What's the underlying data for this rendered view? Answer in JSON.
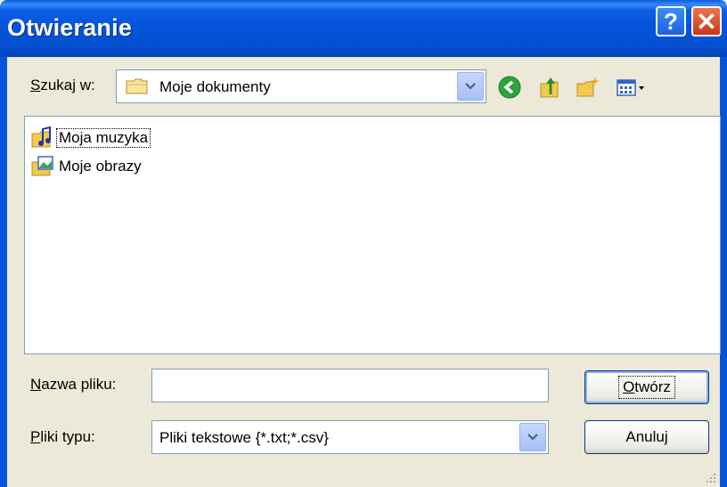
{
  "window": {
    "title": "Otwieranie",
    "help_label": "?",
    "close_label": "✕"
  },
  "lookin": {
    "label_prefix": "S",
    "label_rest": "zukaj w:",
    "value": "Moje dokumenty"
  },
  "toolbar": {
    "icons": [
      "back-icon",
      "up-folder-icon",
      "new-folder-icon",
      "view-menu-icon"
    ]
  },
  "files": [
    {
      "name": "Moja muzyka",
      "icon": "music-folder-icon"
    },
    {
      "name": "Moje obrazy",
      "icon": "pictures-folder-icon"
    }
  ],
  "filename": {
    "label_prefix": "N",
    "label_rest": "azwa pliku:",
    "value": ""
  },
  "filetype": {
    "label_prefix": "P",
    "label_rest": "liki typu:",
    "value": "Pliki tekstowe {*.txt;*.csv}"
  },
  "buttons": {
    "open_prefix": "O",
    "open_rest": "twórz",
    "cancel_label": "Anuluj"
  },
  "colors": {
    "titlebar": "#0453d8",
    "dialog_bg": "#ece9d8",
    "border": "#7f9db9"
  }
}
